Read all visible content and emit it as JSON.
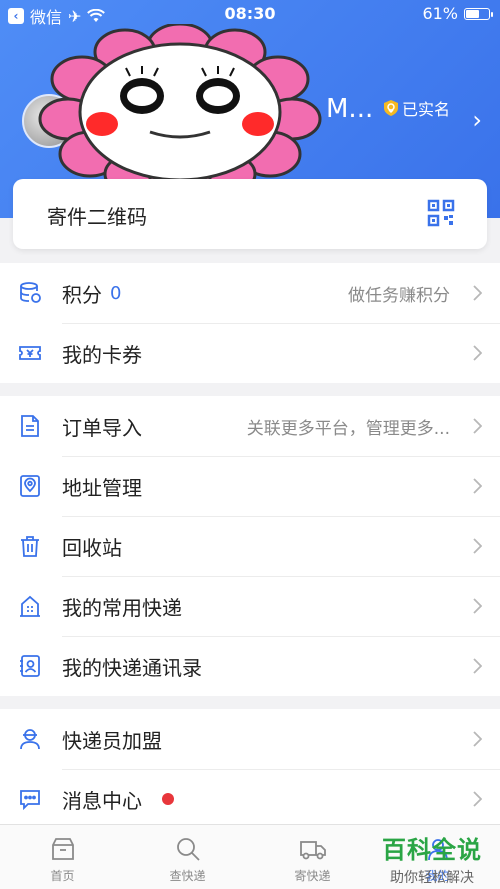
{
  "status_bar": {
    "carrier": "微信",
    "time": "08:30",
    "battery": "61%",
    "battery_level": 0.61
  },
  "profile": {
    "username": "M...",
    "verified_label": "已实名"
  },
  "qr_card": {
    "label": "寄件二维码",
    "icon": "qr-code-icon"
  },
  "section1": [
    {
      "icon": "database-icon",
      "label": "积分",
      "badge": "0",
      "hint": "做任务赚积分"
    },
    {
      "icon": "ticket-icon",
      "label": "我的卡券",
      "hint": ""
    }
  ],
  "section2": [
    {
      "icon": "document-icon",
      "label": "订单导入",
      "hint": "关联更多平台，管理更多..."
    },
    {
      "icon": "location-icon",
      "label": "地址管理",
      "hint": ""
    },
    {
      "icon": "trash-icon",
      "label": "回收站",
      "hint": ""
    },
    {
      "icon": "building-icon",
      "label": "我的常用快递",
      "hint": ""
    },
    {
      "icon": "contacts-icon",
      "label": "我的快递通讯录",
      "hint": ""
    }
  ],
  "section3": [
    {
      "icon": "courier-icon",
      "label": "快递员加盟",
      "hint": ""
    },
    {
      "icon": "message-icon",
      "label": "消息中心",
      "hint": "",
      "red_dot": true
    }
  ],
  "tabs": [
    {
      "icon": "box-icon",
      "label": "首页"
    },
    {
      "icon": "search-icon",
      "label": "查快递"
    },
    {
      "icon": "truck-icon",
      "label": "寄快递"
    },
    {
      "icon": "user-icon",
      "label": "我的"
    }
  ],
  "watermark": {
    "title": "百科全说",
    "subtitle": "助你轻松解决"
  },
  "colors": {
    "header_blue": "#3a72ea",
    "icon_blue": "#3a72ea",
    "red_dot": "#e8363b",
    "watermark_green": "#2aa545"
  }
}
